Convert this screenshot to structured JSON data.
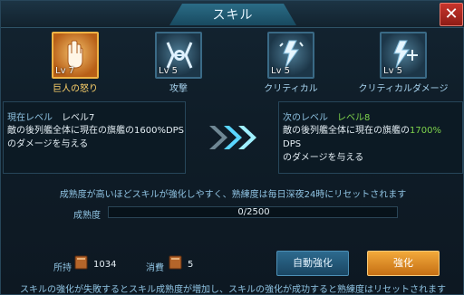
{
  "window": {
    "title": "スキル"
  },
  "close_label": "✕",
  "skills": [
    {
      "name": "巨人の怒り",
      "level": "Lv 7",
      "icon": "fist-icon",
      "selected": true
    },
    {
      "name": "攻撃",
      "level": "Lv 5",
      "icon": "tie-fighter-icon",
      "selected": false
    },
    {
      "name": "クリティカル",
      "level": "Lv 5",
      "icon": "critical-icon",
      "selected": false
    },
    {
      "name": "クリティカルダメージ",
      "level": "Lv 5",
      "icon": "critical-damage-icon",
      "selected": false
    }
  ],
  "current": {
    "label": "現在レベル",
    "level": "レベル7",
    "desc_line1": "敵の後列艦全体に現在の旗艦の1600%DPS",
    "desc_line2": "のダメージを与える"
  },
  "next": {
    "label": "次のレベル",
    "level": "レベル8",
    "desc_pre": "敵の後列艦全体に現在の旗艦の",
    "desc_hl": "1700%",
    "desc_post": " DPS",
    "desc_line2": "のダメージを与える"
  },
  "note": "成熟度が高いほどスキルが強化しやすく、熟練度は毎日深夜24時にリセットされます",
  "proficiency": {
    "label": "成熟度",
    "value": "0/2500",
    "fraction": 0.0
  },
  "resources": {
    "owned_label": "所持",
    "owned_value": "1034",
    "cost_label": "消費",
    "cost_value": "5"
  },
  "buttons": {
    "auto": "自動強化",
    "enhance": "強化"
  },
  "footer": "スキルの強化が失敗するとスキル成熟度が増加し、スキルの強化が成功すると熟練度はリセットされます",
  "colors": {
    "accent": "#f0b445",
    "highlight": "#7ed34c",
    "close": "#c8352c"
  }
}
